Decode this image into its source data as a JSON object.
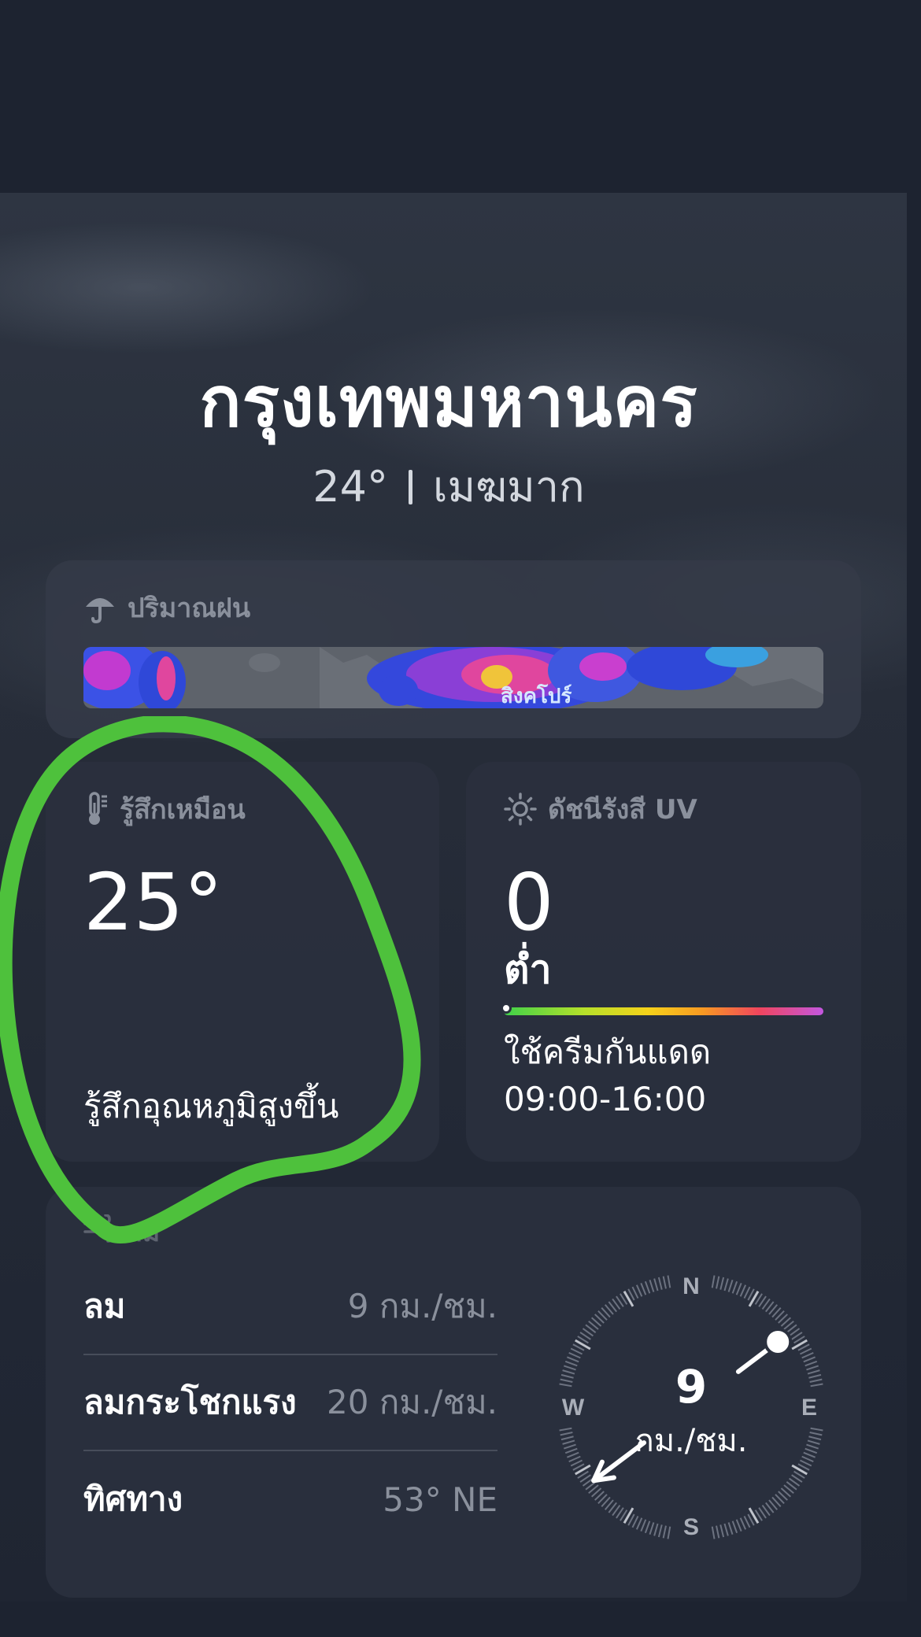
{
  "location": {
    "city": "กรุงเทพมหานคร",
    "temperature": "24°",
    "condition": "เมฆมาก"
  },
  "precipitation_card": {
    "title": "ปริมาณฝน",
    "icon": "umbrella-icon",
    "map_label": "สิงคโปร์"
  },
  "feels_like_card": {
    "title": "รู้สึกเหมือน",
    "icon": "thermometer-icon",
    "value": "25°",
    "description": "รู้สึกอุณหภูมิสูงขึ้น"
  },
  "uv_card": {
    "title": "ดัชนีรังสี UV",
    "icon": "sun-icon",
    "value": "0",
    "level": "ต่ำ",
    "level_fraction": 0.0,
    "advice": "ใช้ครีมกันแดด",
    "hours": "09:00-16:00"
  },
  "wind_card": {
    "title": "ลม",
    "icon": "wind-icon",
    "rows": [
      {
        "label": "ลม",
        "value": "9 กม./ชม."
      },
      {
        "label": "ลมกระโชกแรง",
        "value": "20 กม./ชม."
      },
      {
        "label": "ทิศทาง",
        "value": "53° NE"
      }
    ],
    "compass": {
      "speed": "9",
      "unit": "กม./ชม.",
      "north": "N",
      "east": "E",
      "south": "S",
      "west": "W",
      "direction_degrees": 53
    }
  },
  "annotation": {
    "color": "#4ec13c"
  }
}
